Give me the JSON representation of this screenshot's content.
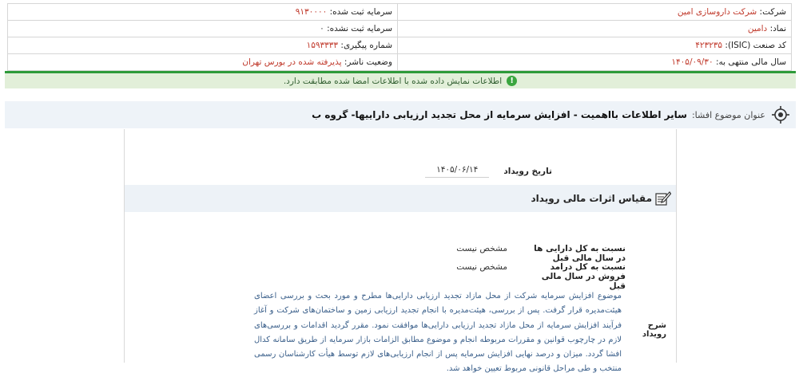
{
  "company": {
    "company_label": "شرکت:",
    "company_value": "شرکت داروسازی امین",
    "symbol_label": "نماد:",
    "symbol_value": "دامین",
    "isic_label": "کد صنعت (ISIC):",
    "isic_value": "۴۲۳۲۳۵",
    "fiscal_year_label": "سال مالی منتهی به:",
    "fiscal_year_value": "۱۴۰۵/۰۹/۳۰",
    "registered_capital_label": "سرمایه ثبت شده:",
    "registered_capital_value": "۹۱۳۰۰۰۰",
    "unregistered_capital_label": "سرمایه ثبت نشده:",
    "unregistered_capital_value": "۰",
    "tracking_label": "شماره پیگیری:",
    "tracking_value": "۱۵۹۳۳۳۳",
    "publisher_status_label": "وضعیت ناشر:",
    "publisher_status_value": "پذیرفته شده در بورس تهران"
  },
  "notice": {
    "text": "اطلاعات نمایش داده شده با اطلاعات امضا شده مطابقت دارد."
  },
  "subject": {
    "label": "عنوان موضوع افشا:",
    "value": "سایر اطلاعات بااهمیت - افزایش سرمایه از محل تجدید ارزیابی داراییها- گروه ب"
  },
  "event": {
    "date_label": "تاریخ رویداد",
    "date_value": "۱۴۰۵/۰۶/۱۴"
  },
  "financial_effects": {
    "heading": "مقیاس اثرات مالی رویداد",
    "rows": [
      {
        "label": "نسبت به کل دارایی ها در سال مالی قبل",
        "value": "مشخص نیست"
      },
      {
        "label": "نسبت به کل درامد فروش در سال مالی قبل",
        "value": "مشخص نیست"
      }
    ]
  },
  "description": {
    "label": "شرح رویداد",
    "text": "موضوع افزایش سرمایه شرکت از محل مازاد تجدید ارزیابی دارایی‌ها مطرح و مورد بحث و بررسی اعضای هیئت‌مدیره قرار گرفت. پس از بررسی، هیئت‌مدیره با انجام تجدید ارزیابی زمین و ساختمان‌های شرکت و آغاز فرآیند افزایش سرمایه از محل مازاد تجدید ارزیابی دارایی‌ها موافقت نمود. مقرر گردید اقدامات و بررسی‌های لازم در چارچوب قوانین و مقررات مربوطه انجام و موضوع مطابق الزامات بازار سرمایه از طریق سامانه کدال افشا گردد. میزان و درصد نهایی افزایش سرمایه پس از انجام ارزیابی‌های لازم توسط هیأت کارشناسان رسمی منتخب و طی مراحل قانونی مربوط تعیین خواهد شد."
  },
  "colors": {
    "accent_red": "#c0392b",
    "notice_green": "#2e9b3a",
    "link_blue": "#3a5f8a"
  }
}
